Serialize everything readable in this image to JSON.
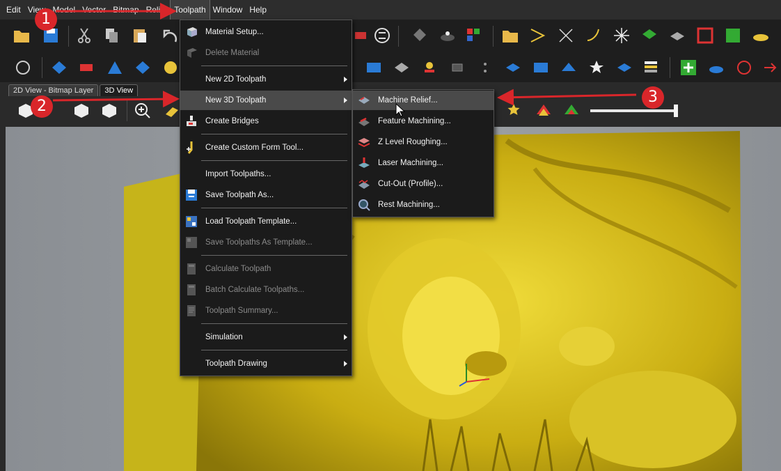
{
  "menubar": {
    "items": [
      "Edit",
      "View",
      "Model",
      "Vector",
      "Bitmap",
      "Relief",
      "Toolpath",
      "Window",
      "Help"
    ]
  },
  "tabs": [
    "2D View - Bitmap Layer",
    "3D View"
  ],
  "toolpath_menu": {
    "items": [
      {
        "label": "Material Setup...",
        "enabled": true
      },
      {
        "label": "Delete Material",
        "enabled": false
      },
      {
        "label": "New 2D Toolpath",
        "enabled": true,
        "submenu": true
      },
      {
        "label": "New 3D Toolpath",
        "enabled": true,
        "submenu": true,
        "highlighted": true
      },
      {
        "label": "Create Bridges",
        "enabled": true
      },
      {
        "label": "Create Custom Form Tool...",
        "enabled": true
      },
      {
        "label": "Import Toolpaths...",
        "enabled": true
      },
      {
        "label": "Save Toolpath As...",
        "enabled": true
      },
      {
        "label": "Load Toolpath Template...",
        "enabled": true
      },
      {
        "label": "Save Toolpaths As Template...",
        "enabled": false
      },
      {
        "label": "Calculate Toolpath",
        "enabled": false
      },
      {
        "label": "Batch Calculate Toolpaths...",
        "enabled": false
      },
      {
        "label": "Toolpath Summary...",
        "enabled": false
      },
      {
        "label": "Simulation",
        "enabled": true,
        "submenu": true
      },
      {
        "label": "Toolpath Drawing",
        "enabled": true,
        "submenu": true
      }
    ]
  },
  "submenu_3d": {
    "items": [
      {
        "label": "Machine Relief...",
        "highlighted": true
      },
      {
        "label": "Feature Machining..."
      },
      {
        "label": "Z Level Roughing..."
      },
      {
        "label": "Laser Machining..."
      },
      {
        "label": "Cut-Out (Profile)..."
      },
      {
        "label": "Rest Machining..."
      }
    ]
  },
  "annotations": {
    "badge1": "1",
    "badge2": "2",
    "badge3": "3",
    "color": "#d9262a"
  },
  "colors": {
    "relief": "#d8c21a",
    "viewport": "#9a9ea2",
    "menu_bg": "#1b1b1b",
    "highlight": "#4a4a4a"
  }
}
